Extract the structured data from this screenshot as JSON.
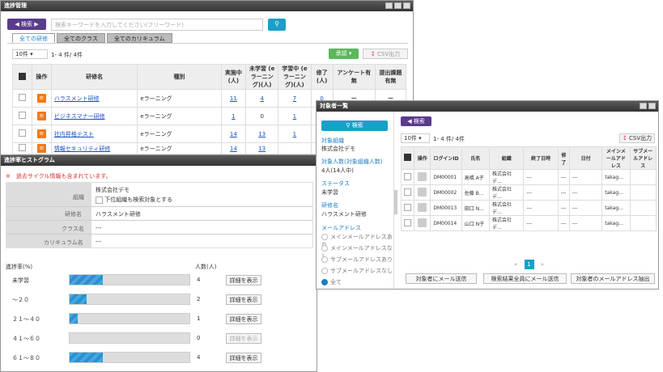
{
  "win1": {
    "title": "進捗管理",
    "back_label": "検索",
    "search_placeholder": "検索キーワードを入力してください(フリーワード)",
    "tabs": [
      "全ての研修",
      "全てのクラス",
      "全てのカリキュラム"
    ],
    "per_page": "10件",
    "count": "1- 4 件/ 4件",
    "approve_label": "承認",
    "csv_label": "CSV出力",
    "headers": [
      "操作",
      "研修名",
      "種別",
      "実施中(人)",
      "未学習 (eラーニング)(人)",
      "学習中 (eラーニング)(人)",
      "修了(人)",
      "アンケート有無",
      "提出課題有無"
    ],
    "rows": [
      {
        "name": "ハラスメント研修",
        "type": "eラーニング",
        "c1": "11",
        "c2": "4",
        "c3": "7",
        "c4": "0",
        "c5": "ー",
        "c6": "ー"
      },
      {
        "name": "ビジネスマナー研修",
        "type": "eラーニング",
        "c1": "1",
        "c2": "0",
        "c3": "1",
        "c4": "",
        "c5": "",
        "c6": ""
      },
      {
        "name": "社内昇格テスト",
        "type": "eラーニング",
        "c1": "14",
        "c2": "13",
        "c3": "1",
        "c4": "",
        "c5": "",
        "c6": ""
      },
      {
        "name": "情報セキュリティ研修",
        "type": "eラーニング",
        "c1": "14",
        "c2": "13",
        "c3": "",
        "c4": "",
        "c5": "",
        "c6": ""
      }
    ]
  },
  "win2": {
    "title": "進捗率ヒストグラム",
    "notice": "※　過去サイクル情報も含まれています。",
    "org_label": "組織",
    "org_value": "株式会社デモ",
    "org_sub": "下位組織も検索対象とする",
    "course_label": "研修名",
    "course_value": "ハラスメント研修",
    "class_label": "クラス名",
    "class_value": "---",
    "curr_label": "カリキュラム名",
    "curr_value": "---",
    "col_rate": "進捗率(%)",
    "col_people": "人数(人)",
    "detail_label": "詳細を表示",
    "hist": [
      {
        "label": "未学習",
        "value": "4",
        "fill": 0.28
      },
      {
        "label": "～２０",
        "value": "2",
        "fill": 0.14
      },
      {
        "label": "２１～４０",
        "value": "1",
        "fill": 0.07
      },
      {
        "label": "４１～６０",
        "value": "0",
        "fill": 0.0
      },
      {
        "label": "６１～８０",
        "value": "4",
        "fill": 0.28
      }
    ]
  },
  "win3": {
    "title": "対象者一覧",
    "search_label": "検索",
    "org_h": "対象組織",
    "org_v": "株式会社デモ",
    "target_h": "対象人数(対象組織人数)",
    "target_v": "4人(14人中)",
    "status_h": "ステータス",
    "status_v": "未学習",
    "course_h": "研修名",
    "course_v": "ハラスメント研修",
    "mail_h": "メールアドレス",
    "mail_opts": [
      "メインメールアドレスあり",
      "メインメールアドレスなし",
      "サブメールアドレスあり",
      "サブメールアドレスなし",
      "全て"
    ],
    "back_label": "検索",
    "csv_label": "CSV出力",
    "per_page": "10件",
    "count": "1- 4 件/ 4件",
    "headers": [
      "操作",
      "ログインID",
      "氏名",
      "組織",
      "終了日時",
      "修了",
      "日付",
      "メインメールアドレス",
      "サブメールアドレス"
    ],
    "rows": [
      {
        "id": "DM00001",
        "name": "高橋 A子",
        "org": "株式会社デ…",
        "end": "---",
        "f": "---",
        "d": "---",
        "main": "takag…"
      },
      {
        "id": "DM00002",
        "name": "佐藤 B…",
        "org": "株式会社デ…",
        "end": "---",
        "f": "---",
        "d": "---",
        "main": "takag…"
      },
      {
        "id": "DM00013",
        "name": "田口 N…",
        "org": "株式会社デ…",
        "end": "---",
        "f": "---",
        "d": "---",
        "main": "takag…"
      },
      {
        "id": "DM00014",
        "name": "山口 N子",
        "org": "株式会社デ…",
        "end": "---",
        "f": "---",
        "d": "---",
        "main": "takag…"
      }
    ],
    "page": "1",
    "btn1": "対象者にメール送信",
    "btn2": "検索結果全員にメール送信",
    "btn3": "対象者のメールアドレス抽出"
  }
}
